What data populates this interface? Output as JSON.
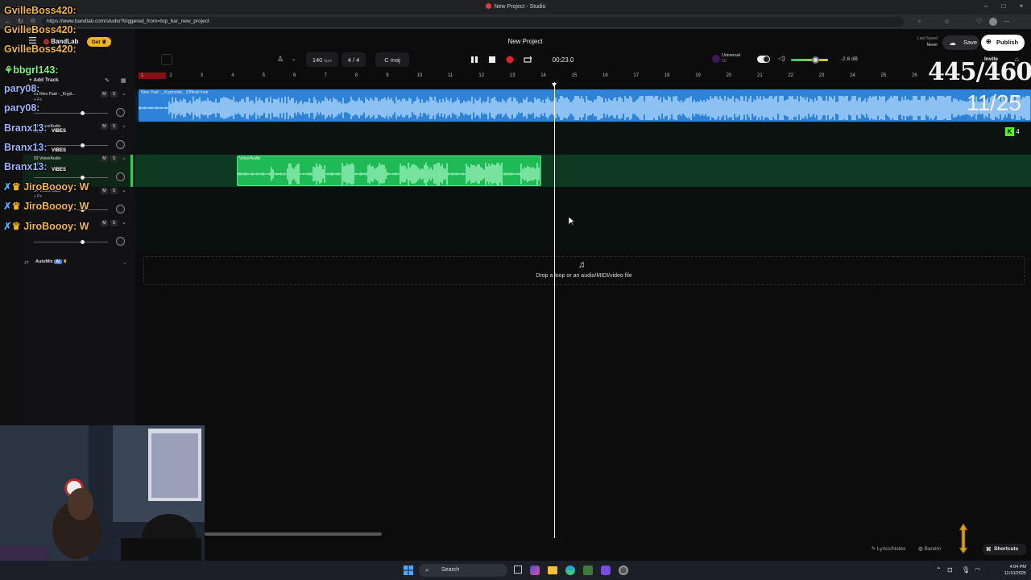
{
  "browser": {
    "window_title": "New Project - Studio",
    "url": "https://www.bandlab.com/studio?triggered_from=top_bar_new_project"
  },
  "app": {
    "brand": "BandLab",
    "get_label": "Get",
    "project_title": "New Project",
    "last_saved_label": "Last Saved",
    "last_saved_value": "Never",
    "save_label": "Save",
    "publish_label": "Publish",
    "invite_label": "Invite"
  },
  "transport": {
    "bpm": "140",
    "bpm_unit": "bpm",
    "time_signature": "4 / 4",
    "key": "C maj",
    "time": "00:23.0"
  },
  "mixer": {
    "preset_label": "Universal",
    "volume_db": "-2.6 dB"
  },
  "ruler": {
    "bars": [
      "1",
      "2",
      "3",
      "4",
      "5",
      "6",
      "7",
      "8",
      "9",
      "10",
      "11",
      "12",
      "13",
      "14",
      "15",
      "16",
      "17",
      "18",
      "19",
      "20",
      "21",
      "22",
      "23",
      "24",
      "25",
      "26"
    ]
  },
  "tracks": [
    {
      "number": "01",
      "name": "Nino Paid - _Krypt...",
      "clip": "Nino Paid - _Kryptonite_ (Official Instr",
      "fx": "+ Fx"
    },
    {
      "number": "02",
      "name": "Voice/Audio",
      "clip": "",
      "fx": "+ Fx"
    },
    {
      "number": "03",
      "name": "Voice/Audio",
      "clip": "Voice/Audio",
      "fx": "+ Fx"
    },
    {
      "number": "04",
      "name": "Voice/Audio",
      "clip": "",
      "fx": "+ Fx"
    },
    {
      "number": "",
      "name": "",
      "clip": "",
      "fx": "+ Fx"
    }
  ],
  "sidebar": {
    "add_track_label": "Add Track",
    "automix_label": "AutoMix",
    "automix_badge": "AI",
    "mute_label": "M",
    "solo_label": "S"
  },
  "dropzone": {
    "text": "Drop a loop or an audio/MIDI/video file"
  },
  "bottom": {
    "lyrics_label": "Lyrics/Notes",
    "bandmate_label": "Bandm",
    "shortcuts_label": "Shortcuts"
  },
  "overlay": {
    "counter_main": "445/460",
    "counter_sub": "11/25",
    "kick_count": "4",
    "chat": [
      {
        "user": "GvilleBoss420:",
        "msg": ""
      },
      {
        "user": "GvilleBoss420:",
        "msg": ""
      },
      {
        "user": "GvilleBoss420:",
        "msg": ""
      },
      {
        "user": "bbgrl143:",
        "msg": ""
      },
      {
        "user": "pary08:",
        "msg": ""
      },
      {
        "user": "pary08:",
        "msg": ""
      },
      {
        "user": "Branx13:",
        "msg": ""
      },
      {
        "user": "Branx13:",
        "msg": ""
      },
      {
        "user": "Branx13:",
        "msg": ""
      },
      {
        "user": "JiroBoooy:",
        "msg": "W"
      },
      {
        "user": "JiroBoooy:",
        "msg": "W"
      },
      {
        "user": "JiroBoooy:",
        "msg": "W"
      }
    ],
    "vibes_tag": "VIBES"
  },
  "taskbar": {
    "search_placeholder": "Search",
    "time": "4:04 PM",
    "date": "11/10/2025"
  },
  "colors": {
    "instrumental_clip": "#3b93e8",
    "voice_clip": "#22d160",
    "record": "#e0202a",
    "playhead": "#ffffff"
  }
}
